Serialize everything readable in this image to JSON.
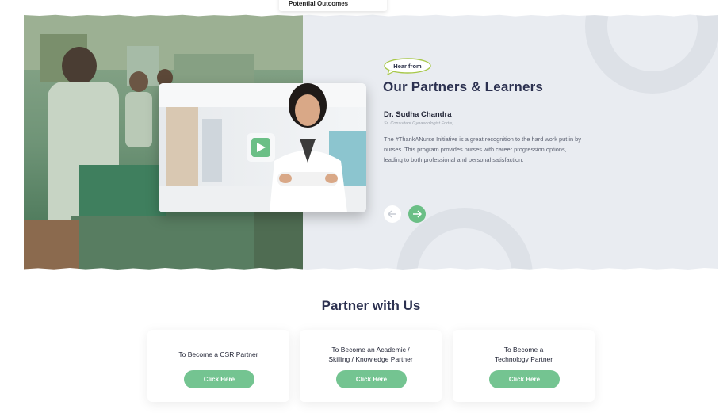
{
  "dropdown": {
    "item_label": "Potential Outcomes"
  },
  "testimonial": {
    "badge": "Hear from",
    "heading": "Our Partners & Learners",
    "name": "Dr. Sudha Chandra",
    "role": "Sr. Consultant Gynaecologist Fortis,",
    "quote": "The #ThankANurse Initiative is a great recognition to the hard work put in by nurses. This program provides nurses with career progression options, leading to both professional and personal satisfaction.",
    "prev_icon": "arrow-left-icon",
    "next_icon": "arrow-right-icon",
    "play_icon": "play-icon"
  },
  "partner": {
    "title": "Partner with Us",
    "cards": [
      {
        "label": "To Become a CSR Partner",
        "button": "Click Here"
      },
      {
        "label": "To Become an Academic /\nSkilling / Knowledge Partner",
        "button": "Click Here"
      },
      {
        "label": "To Become a\nTechnology Partner",
        "button": "Click Here"
      }
    ]
  },
  "colors": {
    "accent_green": "#6bbf86",
    "heading_navy": "#2c3150",
    "band_bg": "#e9ecf1"
  }
}
